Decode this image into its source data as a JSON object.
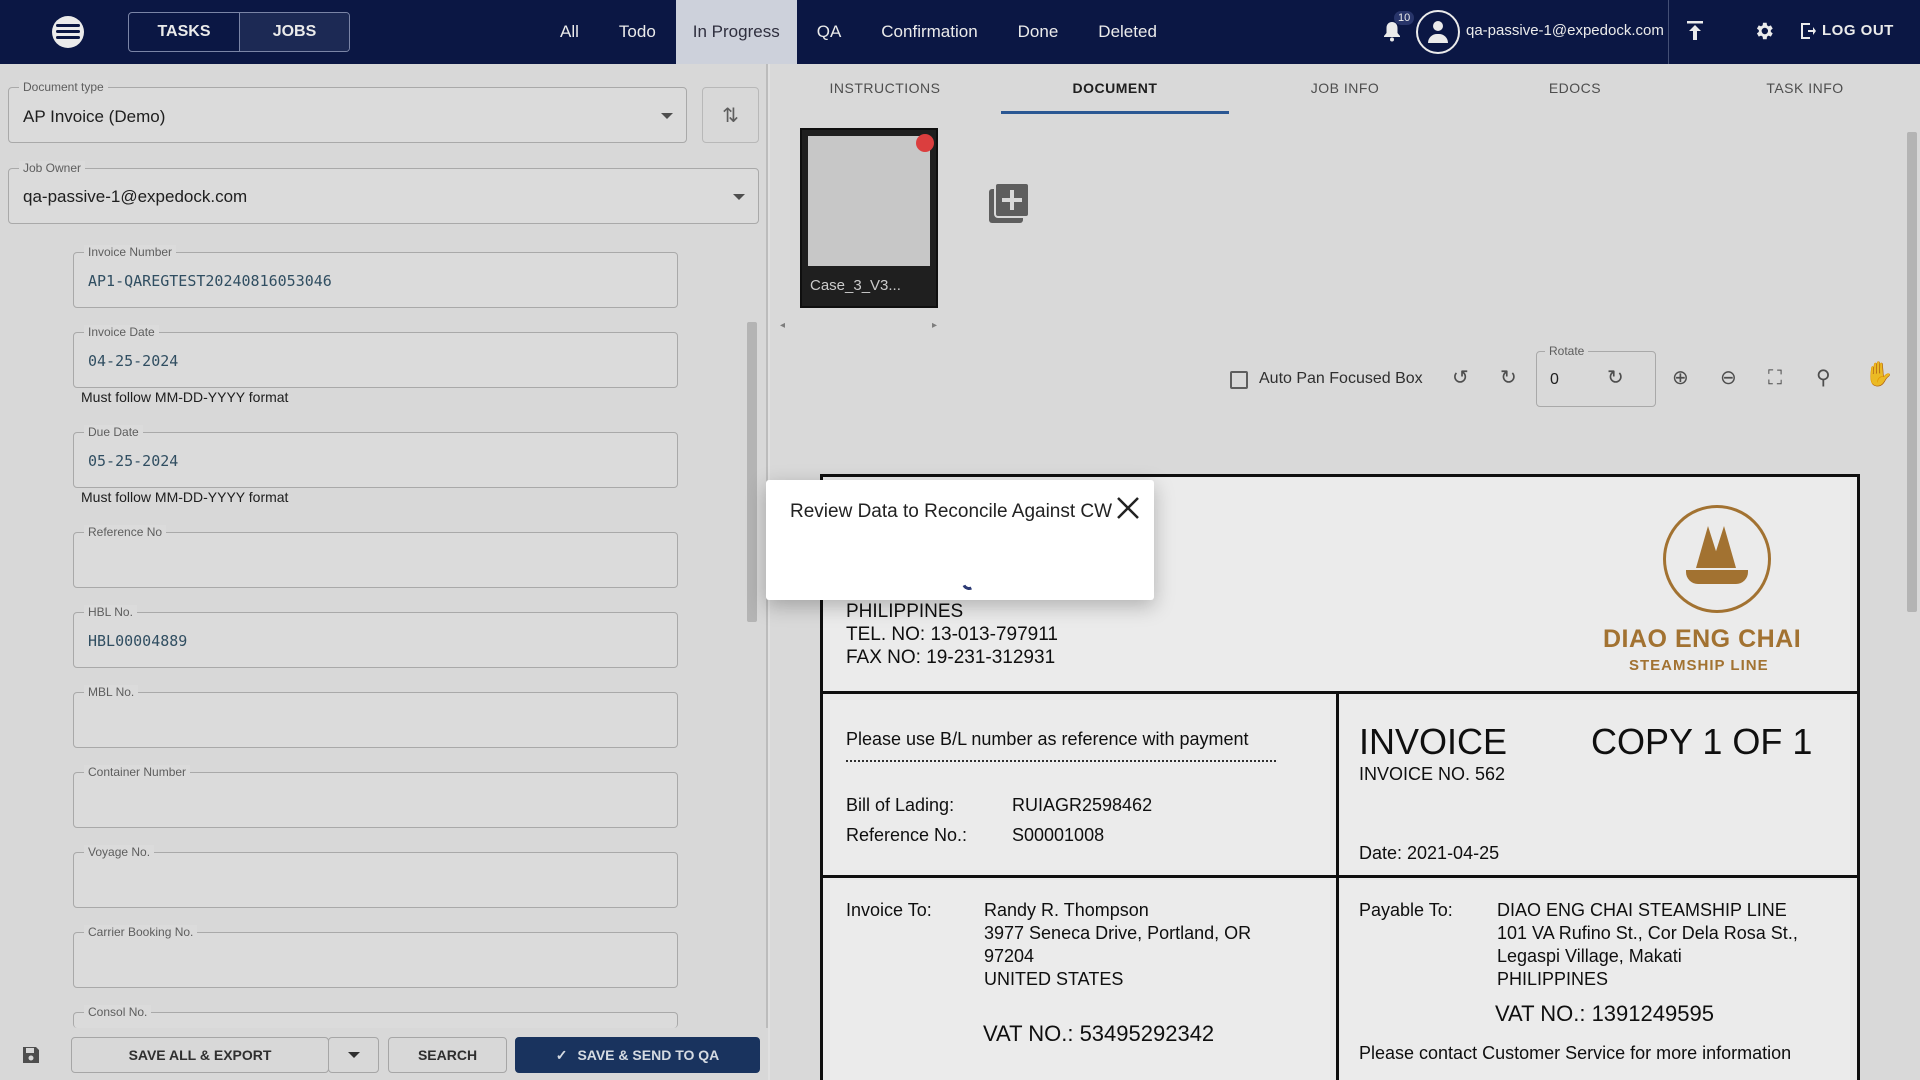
{
  "topbar": {
    "segments": [
      "TASKS",
      "JOBS"
    ],
    "tabs": [
      "All",
      "Todo",
      "In Progress",
      "QA",
      "Confirmation",
      "Done",
      "Deleted"
    ],
    "active_tab": "In Progress",
    "notification_count": "10",
    "user_email": "qa-passive-1@expedock.com",
    "logout_label": "LOG OUT"
  },
  "left": {
    "document_type": {
      "label": "Document type",
      "value": "AP Invoice (Demo)"
    },
    "job_owner": {
      "label": "Job Owner",
      "value": "qa-passive-1@expedock.com"
    },
    "fields": [
      {
        "label": "Invoice Number",
        "value": "AP1-QAREGTEST20240816053046"
      },
      {
        "label": "Invoice Date",
        "value": "04-25-2024",
        "help": "Must follow MM-DD-YYYY format"
      },
      {
        "label": "Due Date",
        "value": "05-25-2024",
        "help": "Must follow MM-DD-YYYY format"
      },
      {
        "label": "Reference No",
        "value": ""
      },
      {
        "label": "HBL No.",
        "value": "HBL00004889"
      },
      {
        "label": "MBL No.",
        "value": ""
      },
      {
        "label": "Container Number",
        "value": ""
      },
      {
        "label": "Voyage No.",
        "value": ""
      },
      {
        "label": "Carrier Booking No.",
        "value": ""
      },
      {
        "label": "Consol No.",
        "value": ""
      }
    ],
    "buttons": {
      "save_all_export": "SAVE ALL & EXPORT",
      "search": "SEARCH",
      "save_send_qa": "SAVE & SEND TO QA"
    }
  },
  "right": {
    "tabs": [
      "INSTRUCTIONS",
      "DOCUMENT",
      "JOB INFO",
      "EDOCS",
      "TASK INFO"
    ],
    "active_tab": "DOCUMENT",
    "thumbnail_label": "Case_3_V3...",
    "auto_pan_label": "Auto Pan Focused Box",
    "rotate": {
      "label": "Rotate",
      "value": "0"
    }
  },
  "invoice": {
    "addr_lines": [
      "PHILIPPINES",
      "TEL. NO: 13-013-797911",
      "FAX NO: 19-231-312931"
    ],
    "brand": "DIAO ENG CHAI",
    "brand_sub": "STEAMSHIP LINE",
    "ref_note": "Please use B/L number as reference with payment",
    "bol_label": "Bill of Lading:",
    "bol_value": "RUIAGR2598462",
    "refno_label": "Reference No.:",
    "refno_value": "S00001008",
    "title": "INVOICE",
    "copy": "COPY 1 OF 1",
    "invoice_no": "INVOICE NO. 562",
    "date": "Date: 2021-04-25",
    "invoice_to_label": "Invoice To:",
    "invoice_to": [
      "Randy R. Thompson",
      "3977 Seneca Drive, Portland, OR",
      "97204",
      "UNITED STATES"
    ],
    "vat_left": "VAT NO.: 53495292342",
    "payable_to_label": "Payable To:",
    "payable_to": [
      "DIAO ENG CHAI STEAMSHIP LINE",
      "101 VA Rufino St., Cor Dela Rosa St.,",
      "Legaspi Village, Makati",
      "PHILIPPINES"
    ],
    "vat_right": "VAT NO.: 1391249595",
    "contact": "Please contact Customer Service for more information"
  },
  "modal": {
    "title": "Review Data to Reconcile Against CW"
  }
}
